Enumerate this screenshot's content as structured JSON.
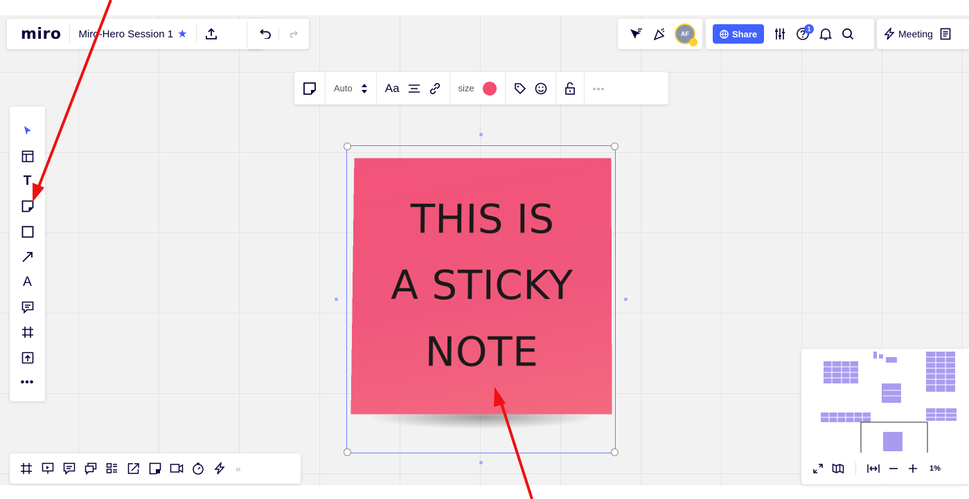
{
  "app": {
    "logo": "miro",
    "board_name": "Miro-Hero Session 1"
  },
  "colors": {
    "accent": "#4262ff",
    "sticky": "#f24d6e",
    "annotation_arrow": "#ee1111",
    "selection": "#6a7dff"
  },
  "top_right": {
    "avatar_initials": "AF",
    "share_label": "Share",
    "help_badge": "1",
    "meeting_label": "Meeting"
  },
  "context_toolbar": {
    "sticky_size": "Auto",
    "font_label": "Aa",
    "size_label": "size",
    "color": "#f24d6e"
  },
  "left_toolbar": {
    "text_tool": "T",
    "pen_tool": "A"
  },
  "sticky_note": {
    "lines": [
      "THIS IS",
      "A STICKY",
      "NOTE"
    ]
  },
  "minimap": {
    "zoom": "1%"
  }
}
